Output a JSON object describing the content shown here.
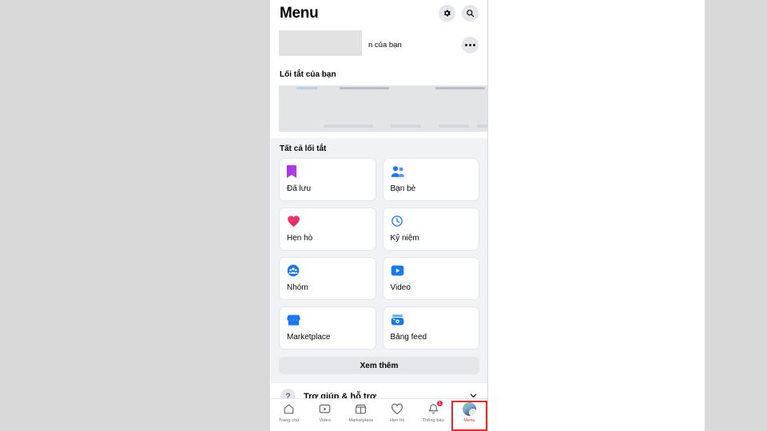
{
  "header": {
    "title": "Menu",
    "settings_icon": "gear-icon",
    "search_icon": "search-icon"
  },
  "profile": {
    "name_redacted": "",
    "subtitle": "n của bạn",
    "more_icon": "ellipsis-icon"
  },
  "sections": {
    "shortcuts_heading": "Lối tắt của bạn",
    "all_shortcuts_heading": "Tất cả lối tắt"
  },
  "shortcuts": [
    {
      "label": "Đã lưu",
      "icon": "bookmark-icon"
    },
    {
      "label": "Bạn bè",
      "icon": "friends-icon"
    },
    {
      "label": "Hẹn hò",
      "icon": "heart-icon"
    },
    {
      "label": "Kỷ niệm",
      "icon": "clock-icon"
    },
    {
      "label": "Nhóm",
      "icon": "groups-icon"
    },
    {
      "label": "Video",
      "icon": "video-icon"
    },
    {
      "label": "Marketplace",
      "icon": "storefront-icon"
    },
    {
      "label": "Bảng feed",
      "icon": "feeds-icon"
    }
  ],
  "see_more": {
    "label": "Xem thêm"
  },
  "help": {
    "label": "Trợ giúp & hỗ trợ",
    "icon": "question-mark-icon",
    "chevron": "chevron-down-icon"
  },
  "bottom_nav": [
    {
      "label": "Trang chủ",
      "icon": "home-icon",
      "badge": "",
      "selected": false
    },
    {
      "label": "Video",
      "icon": "video-icon",
      "badge": "",
      "selected": false
    },
    {
      "label": "Marketplace",
      "icon": "storefront-icon",
      "badge": "",
      "selected": false
    },
    {
      "label": "Hẹn hò",
      "icon": "heart-icon",
      "badge": "",
      "selected": false
    },
    {
      "label": "Thông báo",
      "icon": "bell-icon",
      "badge": "1",
      "selected": false
    },
    {
      "label": "Menu",
      "icon": "avatar-menu-icon",
      "badge": "",
      "selected": true
    }
  ],
  "colors": {
    "page_background": "#d9d9d9",
    "app_background": "#f0f2f5",
    "card_background": "#ffffff",
    "accent_blue": "#1877f2",
    "highlight_red": "#e8252a",
    "badge_red": "#e41e3f",
    "text_primary": "#050505",
    "text_secondary": "#65676b"
  }
}
